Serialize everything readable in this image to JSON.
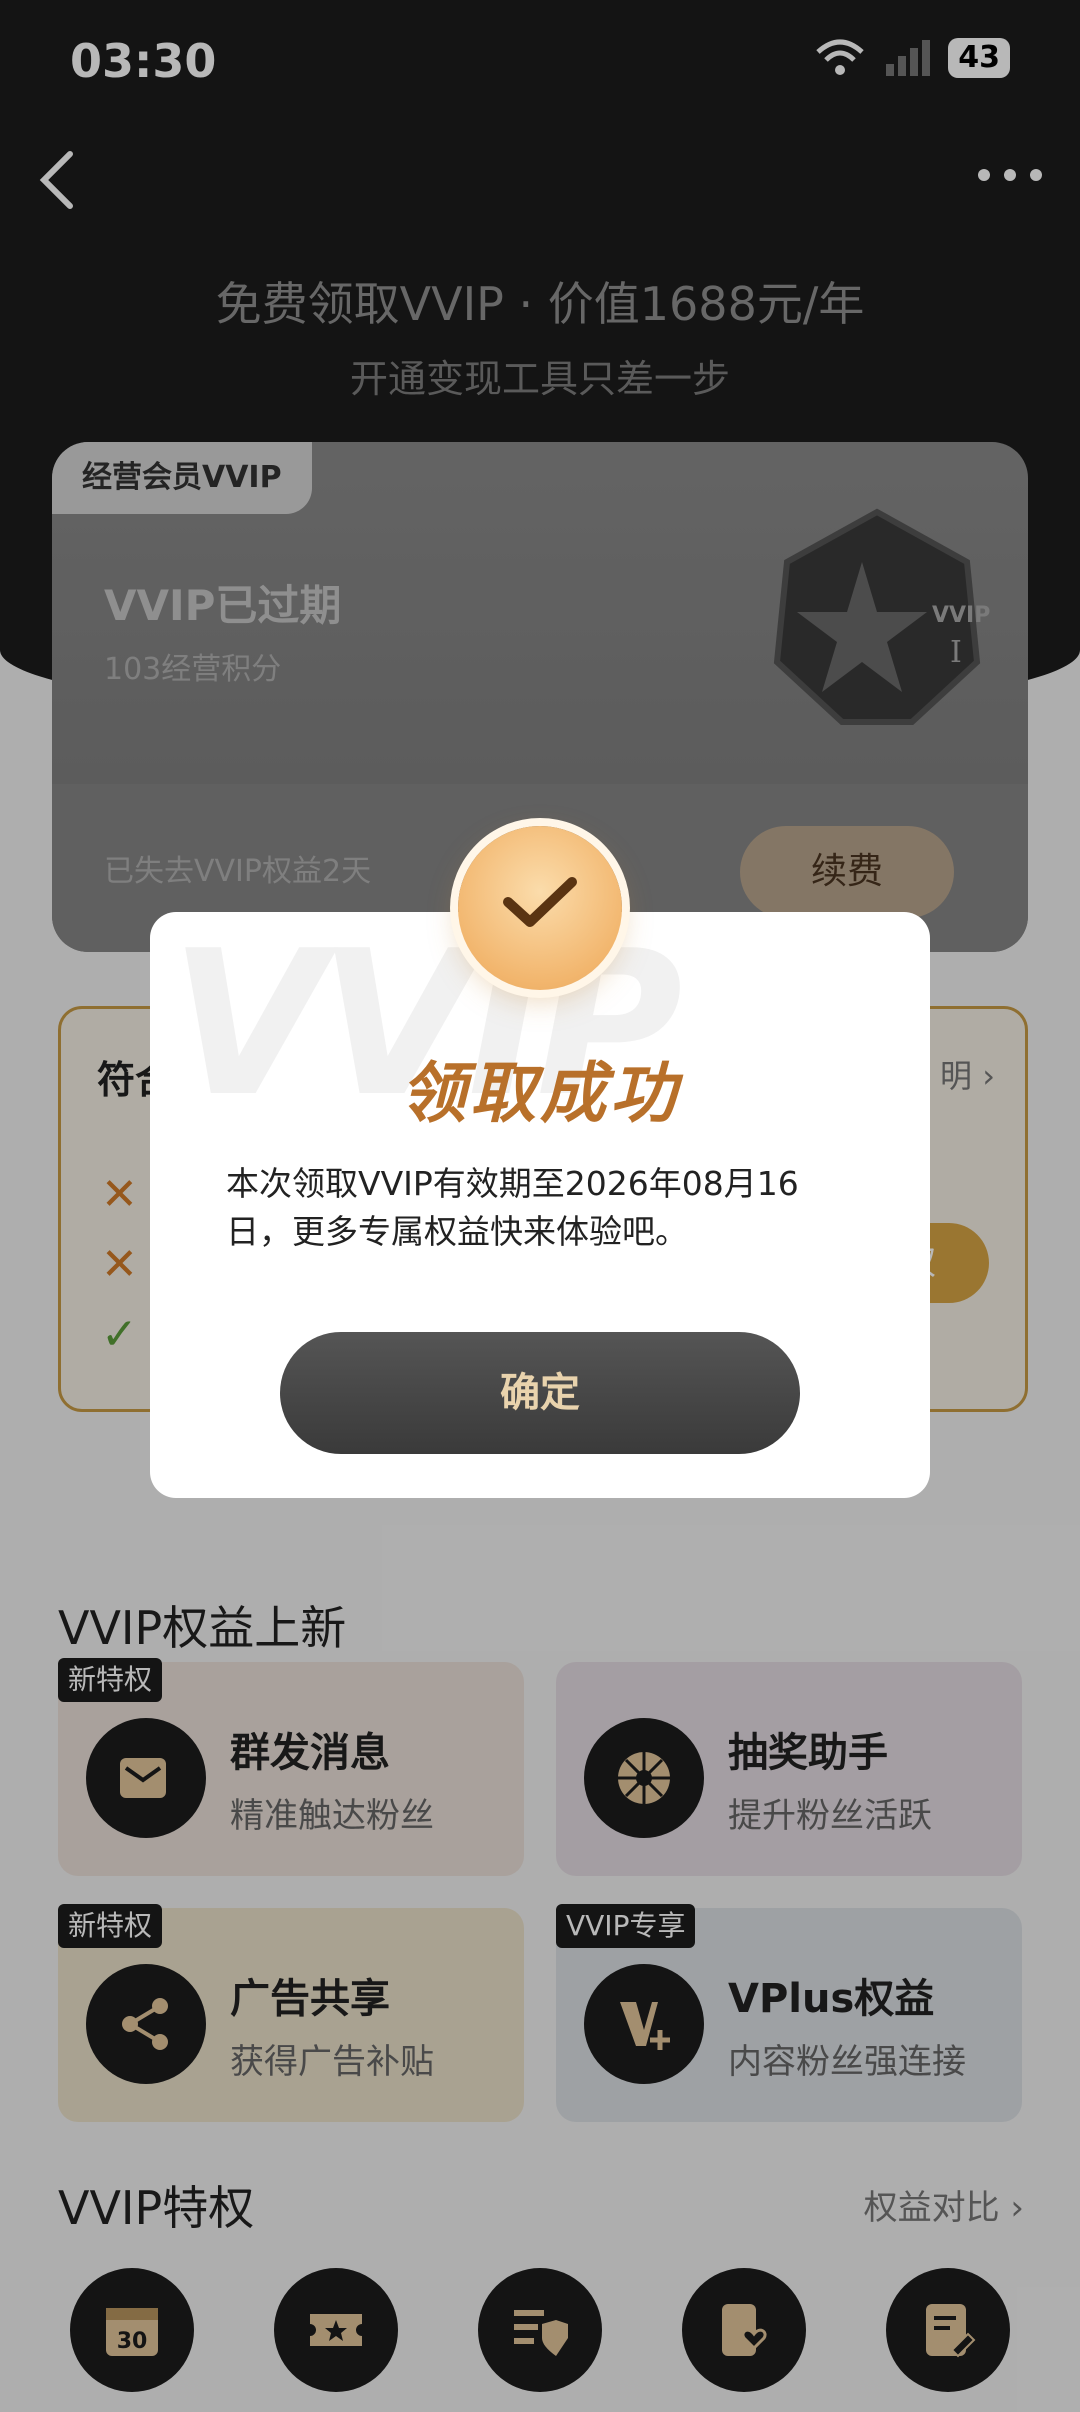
{
  "status_bar": {
    "time": "03:30",
    "battery": "43"
  },
  "header": {
    "title": "免费领取VVIP · 价值1688元/年",
    "subtitle": "开通变现工具只差一步"
  },
  "member_card": {
    "tag": "经营会员VVIP",
    "status": "VVIP已过期",
    "points": "103经营积分",
    "lost_text": "已失去VVIP权益2天",
    "renew_label": "续费",
    "badge_label": "VVIP",
    "badge_level": "I"
  },
  "conditions": {
    "title": "符合",
    "link": "明",
    "button": "权"
  },
  "benefits_section": {
    "title": "VVIP权益上新",
    "items": [
      {
        "tag": "新特权",
        "name": "群发消息",
        "desc": "精准触达粉丝",
        "icon": "message-icon"
      },
      {
        "tag": "",
        "name": "抽奖助手",
        "desc": "提升粉丝活跃",
        "icon": "lottery-wheel-icon"
      },
      {
        "tag": "新特权",
        "name": "广告共享",
        "desc": "获得广告补贴",
        "icon": "share-icon"
      },
      {
        "tag": "VVIP专享",
        "name": "VPlus权益",
        "desc": "内容粉丝强连接",
        "icon": "vplus-icon"
      }
    ]
  },
  "privileges_section": {
    "title": "VVIP特权",
    "link": "权益对比",
    "calendar_number": "30"
  },
  "modal": {
    "watermark": "VVIP",
    "title": "领取成功",
    "message": "本次领取VVIP有效期至2026年08月16日，更多专属权益快来体验吧。",
    "confirm_label": "确定"
  },
  "colors": {
    "gold": "#b8702a",
    "dark": "#1c1c1c",
    "check_gradient": "#f2b66e"
  }
}
